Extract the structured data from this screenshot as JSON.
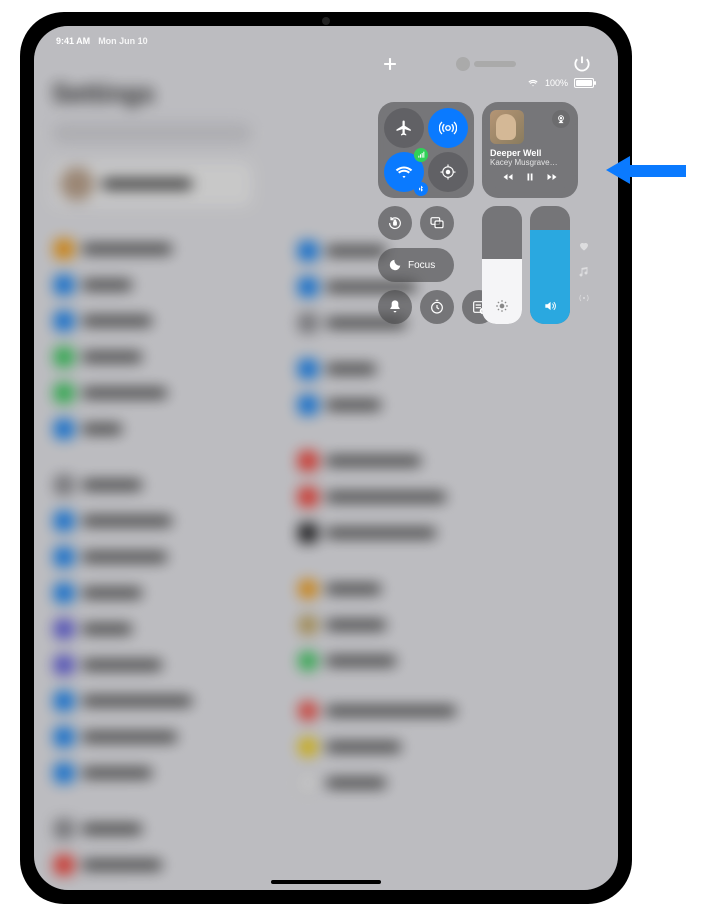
{
  "status": {
    "time": "9:41 AM",
    "date": "Mon Jun 10",
    "battery_pct": "100%"
  },
  "bg": {
    "heading": "Settings"
  },
  "cc": {
    "media": {
      "title": "Deeper Well",
      "artist": "Kacey Musgrave…"
    },
    "focus_label": "Focus"
  },
  "colors": {
    "accent": "#0a7aff"
  }
}
